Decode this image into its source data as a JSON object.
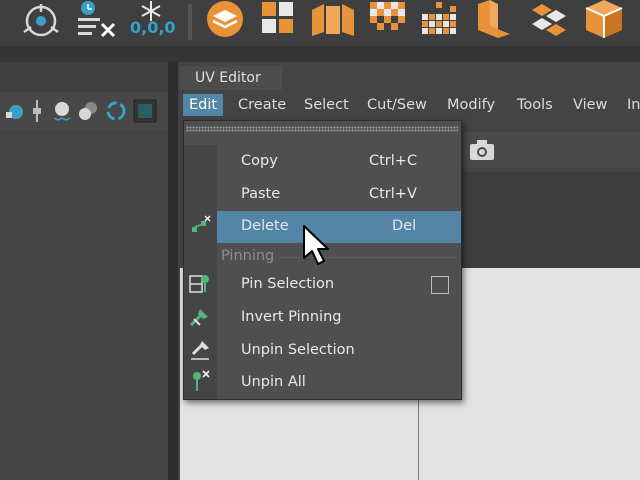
{
  "colors": {
    "highlight": "#5285a6",
    "shelf_orange": "#e8923a",
    "shelf_blue": "#3aa0c8",
    "pin_green": "#4fb87a"
  },
  "shelf": {
    "icons": [
      "pivot-gizmo-icon",
      "reset-transform-icon",
      "freeze-transform-icon",
      "layers-icon",
      "checker-grid-icon",
      "unfold-box-icon",
      "checker-dense-icon",
      "checker-grid-2-icon",
      "stack-box-icon",
      "layout-diamond-icon",
      "box-3d-icon"
    ],
    "freeze_label": "0,0,0"
  },
  "editor": {
    "tab_title": "UV Editor",
    "menu": [
      "Edit",
      "Create",
      "Select",
      "Cut/Sew",
      "Modify",
      "Tools",
      "View",
      "In"
    ]
  },
  "dropdown": {
    "items": [
      {
        "label": "Copy",
        "shortcut": "Ctrl+C"
      },
      {
        "label": "Paste",
        "shortcut": "Ctrl+V"
      },
      {
        "label": "Delete",
        "shortcut": "Del"
      }
    ],
    "section": "Pinning",
    "pinning_items": [
      {
        "label": "Pin Selection",
        "icon": "pin-selection-icon",
        "has_checkbox": true
      },
      {
        "label": "Invert Pinning",
        "icon": "invert-pinning-icon"
      },
      {
        "label": "Unpin Selection",
        "icon": "unpin-selection-icon"
      },
      {
        "label": "Unpin All",
        "icon": "unpin-all-icon"
      }
    ]
  }
}
